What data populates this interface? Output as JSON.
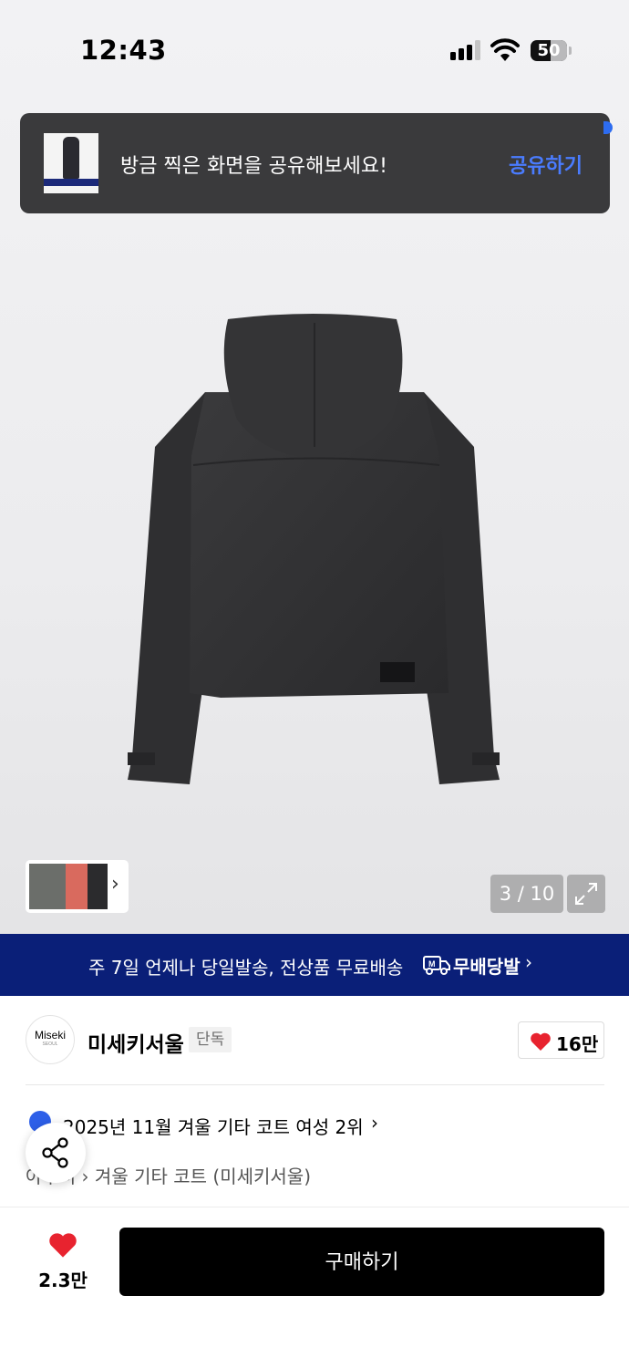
{
  "status_bar": {
    "time": "12:43",
    "battery": "50"
  },
  "toast": {
    "message": "방금 찍은 화면을 공유해보세요!",
    "action_label": "공유하기"
  },
  "gallery": {
    "counter": "3 / 10",
    "expand_icon": "expand-icon",
    "thumb_chevron": "›"
  },
  "promo_banner": {
    "text": "주 7일 언제나 당일발송, 전상품 무료배송",
    "brand": "무배당발",
    "chevron": "›",
    "color": "#0a1f78"
  },
  "brand": {
    "logo_text": "Miseki",
    "logo_sub": "SEOUL",
    "name": "미세키서울",
    "tag": "단독",
    "likes": "16만"
  },
  "ranking": {
    "text": "2025년 11월 겨울 기타 코트 여성 2위",
    "chevron": "›"
  },
  "category": {
    "text": "아우터 › 겨울 기타 코트 (미세키서울)"
  },
  "bottom_bar": {
    "wish_count": "2.3만",
    "buy_label": "구매하기",
    "heart_color": "#e8232f"
  }
}
